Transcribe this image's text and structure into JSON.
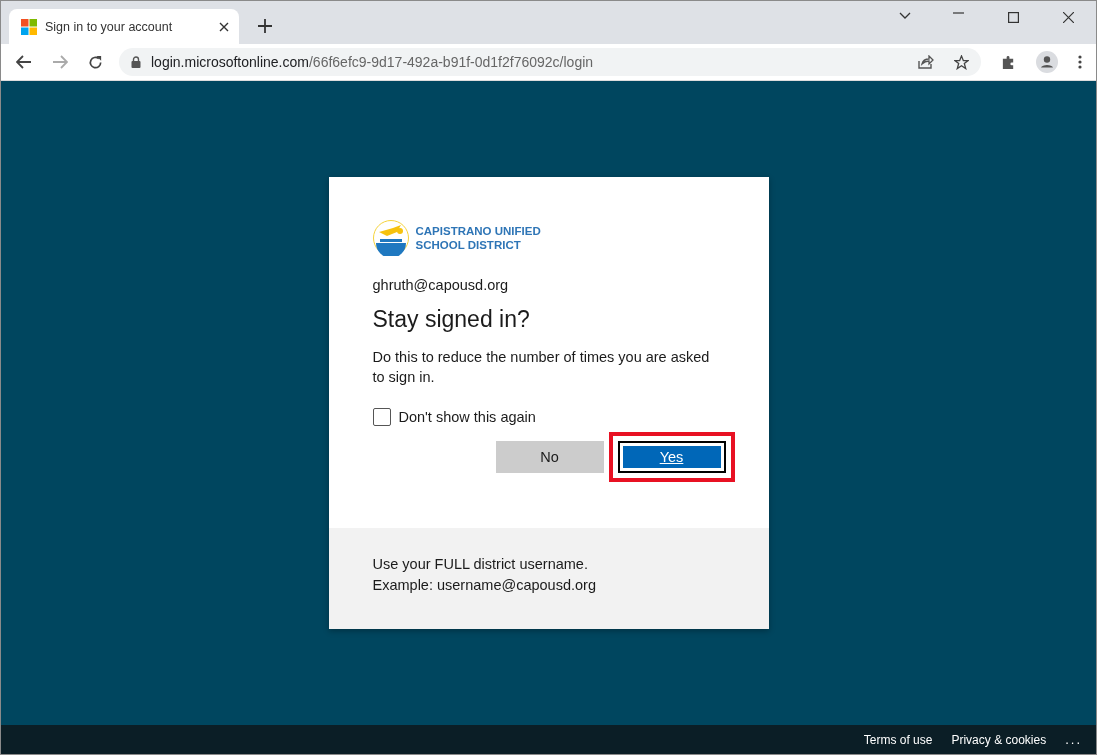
{
  "browser": {
    "tab_title": "Sign in to your account",
    "address": {
      "host": "login.microsoftonline.com",
      "path": "/66f6efc9-9d17-492a-b91f-0d1f2f76092c/login"
    }
  },
  "card": {
    "logo_lines": [
      "CAPISTRANO UNIFIED",
      "SCHOOL DISTRICT"
    ],
    "email": "ghruth@capousd.org",
    "title": "Stay signed in?",
    "description": "Do this to reduce the number of times you are asked to sign in.",
    "checkbox": {
      "label": "Don't show this again",
      "checked": false
    },
    "buttons": [
      {
        "label": "No",
        "kind": "secondary",
        "highlighted": false
      },
      {
        "label": "Yes",
        "kind": "primary",
        "highlighted": true
      }
    ],
    "footer_lines": [
      "Use your FULL district username.",
      "Example: username@capousd.org"
    ]
  },
  "footer": {
    "links": [
      "Terms of use",
      "Privacy & cookies"
    ],
    "more": "..."
  }
}
